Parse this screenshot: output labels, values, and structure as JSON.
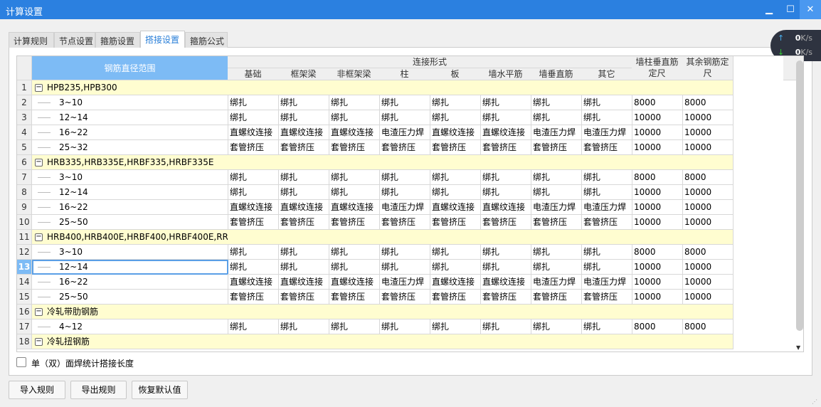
{
  "window": {
    "title": "计算设置",
    "minimize": "▁",
    "maximize": "☐",
    "close": "✕"
  },
  "tabs": [
    {
      "label": "计算规则"
    },
    {
      "label": "节点设置"
    },
    {
      "label": "箍筋设置"
    },
    {
      "label": "搭接设置",
      "active": true
    },
    {
      "label": "箍筋公式"
    }
  ],
  "net_monitor": {
    "up": "0",
    "down": "0",
    "unit": "K/s"
  },
  "grid": {
    "range_header": "钢筋直径范围",
    "group_header": "连接形式",
    "columns": [
      "基础",
      "框架梁",
      "非框架梁",
      "柱",
      "板",
      "墙水平筋",
      "墙垂直筋",
      "其它"
    ],
    "extra_columns": [
      "墙柱垂直筋定尺",
      "其余钢筋定尺"
    ],
    "selected_row": 13,
    "rows": [
      {
        "n": "1",
        "group": true,
        "range": "HPB235,HPB300",
        "cells": []
      },
      {
        "n": "2",
        "range": "3~10",
        "cells": [
          "绑扎",
          "绑扎",
          "绑扎",
          "绑扎",
          "绑扎",
          "绑扎",
          "绑扎",
          "绑扎",
          "8000",
          "8000"
        ]
      },
      {
        "n": "3",
        "range": "12~14",
        "cells": [
          "绑扎",
          "绑扎",
          "绑扎",
          "绑扎",
          "绑扎",
          "绑扎",
          "绑扎",
          "绑扎",
          "10000",
          "10000"
        ]
      },
      {
        "n": "4",
        "range": "16~22",
        "cells": [
          "直螺纹连接",
          "直螺纹连接",
          "直螺纹连接",
          "电渣压力焊",
          "直螺纹连接",
          "直螺纹连接",
          "电渣压力焊",
          "电渣压力焊",
          "10000",
          "10000"
        ]
      },
      {
        "n": "5",
        "range": "25~32",
        "cells": [
          "套管挤压",
          "套管挤压",
          "套管挤压",
          "套管挤压",
          "套管挤压",
          "套管挤压",
          "套管挤压",
          "套管挤压",
          "10000",
          "10000"
        ]
      },
      {
        "n": "6",
        "group": true,
        "range": "HRB335,HRB335E,HRBF335,HRBF335E",
        "cells": []
      },
      {
        "n": "7",
        "range": "3~10",
        "cells": [
          "绑扎",
          "绑扎",
          "绑扎",
          "绑扎",
          "绑扎",
          "绑扎",
          "绑扎",
          "绑扎",
          "8000",
          "8000"
        ]
      },
      {
        "n": "8",
        "range": "12~14",
        "cells": [
          "绑扎",
          "绑扎",
          "绑扎",
          "绑扎",
          "绑扎",
          "绑扎",
          "绑扎",
          "绑扎",
          "10000",
          "10000"
        ]
      },
      {
        "n": "9",
        "range": "16~22",
        "cells": [
          "直螺纹连接",
          "直螺纹连接",
          "直螺纹连接",
          "电渣压力焊",
          "直螺纹连接",
          "直螺纹连接",
          "电渣压力焊",
          "电渣压力焊",
          "10000",
          "10000"
        ]
      },
      {
        "n": "10",
        "range": "25~50",
        "cells": [
          "套管挤压",
          "套管挤压",
          "套管挤压",
          "套管挤压",
          "套管挤压",
          "套管挤压",
          "套管挤压",
          "套管挤压",
          "10000",
          "10000"
        ]
      },
      {
        "n": "11",
        "group": true,
        "range": "HRB400,HRB400E,HRBF400,HRBF400E,RR...",
        "cells": []
      },
      {
        "n": "12",
        "range": "3~10",
        "cells": [
          "绑扎",
          "绑扎",
          "绑扎",
          "绑扎",
          "绑扎",
          "绑扎",
          "绑扎",
          "绑扎",
          "8000",
          "8000"
        ]
      },
      {
        "n": "13",
        "range": "12~14",
        "cells": [
          "绑扎",
          "绑扎",
          "绑扎",
          "绑扎",
          "绑扎",
          "绑扎",
          "绑扎",
          "绑扎",
          "10000",
          "10000"
        ]
      },
      {
        "n": "14",
        "range": "16~22",
        "cells": [
          "直螺纹连接",
          "直螺纹连接",
          "直螺纹连接",
          "电渣压力焊",
          "直螺纹连接",
          "直螺纹连接",
          "电渣压力焊",
          "电渣压力焊",
          "10000",
          "10000"
        ]
      },
      {
        "n": "15",
        "range": "25~50",
        "cells": [
          "套管挤压",
          "套管挤压",
          "套管挤压",
          "套管挤压",
          "套管挤压",
          "套管挤压",
          "套管挤压",
          "套管挤压",
          "10000",
          "10000"
        ]
      },
      {
        "n": "16",
        "group": true,
        "range": "冷轧带肋钢筋",
        "cells": []
      },
      {
        "n": "17",
        "range": "4~12",
        "cells": [
          "绑扎",
          "绑扎",
          "绑扎",
          "绑扎",
          "绑扎",
          "绑扎",
          "绑扎",
          "绑扎",
          "8000",
          "8000"
        ]
      },
      {
        "n": "18",
        "group": true,
        "range": "冷轧扭钢筋",
        "cells": []
      }
    ]
  },
  "checkbox": {
    "label": "单（双）面焊统计搭接长度",
    "checked": false
  },
  "buttons": {
    "import": "导入规则",
    "export": "导出规则",
    "restore": "恢复默认值"
  }
}
